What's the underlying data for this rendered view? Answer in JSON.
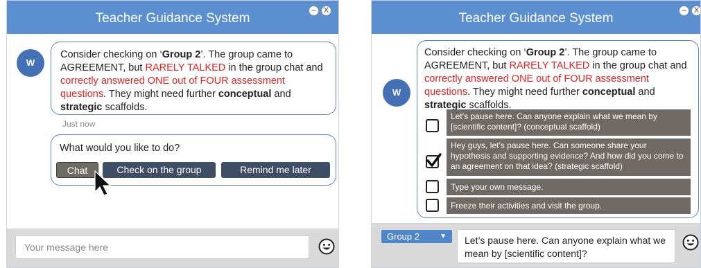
{
  "left": {
    "title": "Teacher Guidance System",
    "window_controls": {
      "minimize": "–",
      "close": "X"
    },
    "avatar_initial": "W",
    "message": {
      "p1": "Consider checking on ",
      "quote_open": "‘",
      "group": "Group 2",
      "p2": "’. The group came to AGREEMENT, but ",
      "rarely": "RARELY TALKED",
      "p3": " in the group chat and ",
      "correct": "correctly answered ONE out of FOUR assessment questions",
      "p4": ". They might need further ",
      "conceptual": "conceptual",
      "p5": " and ",
      "strategic": "strategic",
      "p6": " scaffolds."
    },
    "timestamp": "Just now",
    "prompt": "What would you like to do?",
    "buttons": {
      "chat": "Chat",
      "check": "Check on the group",
      "remind": "Remind me later"
    },
    "input_placeholder": "Your message here"
  },
  "right": {
    "title": "Teacher Guidance System",
    "window_controls": {
      "minimize": "–",
      "close": "X"
    },
    "avatar_initial": "W",
    "message": {
      "p1": "Consider checking on ",
      "quote_open": "‘",
      "group": "Group 2",
      "p2": "’. The group came to AGREEMENT, but ",
      "rarely": "RARELY TALKED",
      "p3": " in the group chat and ",
      "correct": "correctly answered ONE out of FOUR assessment questions",
      "p4": ". They might need further ",
      "conceptual": "conceptual",
      "p5": " and ",
      "strategic": "strategic",
      "p6": " scaffolds."
    },
    "options": [
      {
        "text": "Let’s pause here. Can anyone explain what we mean by [scientific content]? (conceptual scaffold)",
        "checked": false
      },
      {
        "text": "Hey guys, let’s pause here. Can someone share your hypothesis and supporting evidence? And how did you come to an agreement on that idea? (strategic scaffold)",
        "checked": true
      },
      {
        "text": "Type your own message.",
        "checked": false
      },
      {
        "text": "Freeze their activities and visit the group.",
        "checked": false
      }
    ],
    "group_select": "Group 2",
    "composed_message": "Let’s pause here. Can anyone explain what we mean by [scientific content]?"
  },
  "colors": {
    "titlebar": "#5b8fcf",
    "alert_red": "#e02323",
    "option_bg": "#6f6a66",
    "button_bg": "#3f4e64",
    "avatar": "#4470b4"
  },
  "icons": [
    "minimize-icon",
    "close-icon",
    "cursor-arrow-icon",
    "checkmark-icon",
    "smiley-icon",
    "dropdown-caret-icon"
  ]
}
